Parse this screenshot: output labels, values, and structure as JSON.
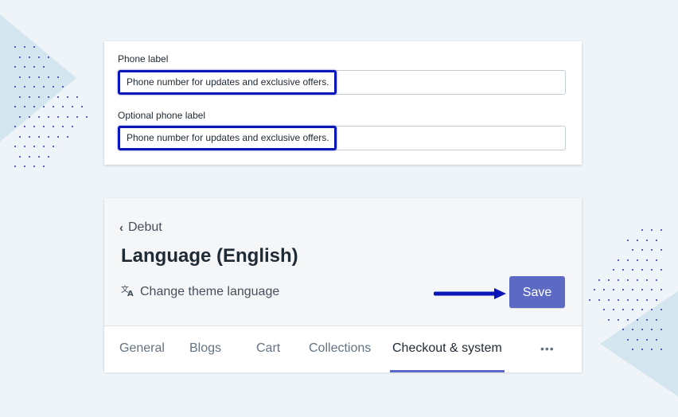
{
  "form_fields": [
    {
      "label": "Phone label",
      "value": "Phone number for updates and exclusive offers."
    },
    {
      "label": "Optional phone label",
      "value": "Phone number for updates and exclusive offers."
    }
  ],
  "header": {
    "back_label": "Debut",
    "title": "Language (English)",
    "change_language_label": "Change theme language",
    "save_label": "Save"
  },
  "tabs": [
    {
      "label": "General"
    },
    {
      "label": "Blogs"
    },
    {
      "label": "Cart"
    },
    {
      "label": "Collections"
    },
    {
      "label": "Checkout & system",
      "active": true
    },
    {
      "label": "•••"
    }
  ],
  "icons": {
    "back": "chevron-left-icon",
    "language": "translate-icon",
    "more": "more-horizontal-icon"
  },
  "colors": {
    "accent": "#5c6ac4",
    "highlight_box": "#0a16b8",
    "arrow": "#0a16b8"
  }
}
